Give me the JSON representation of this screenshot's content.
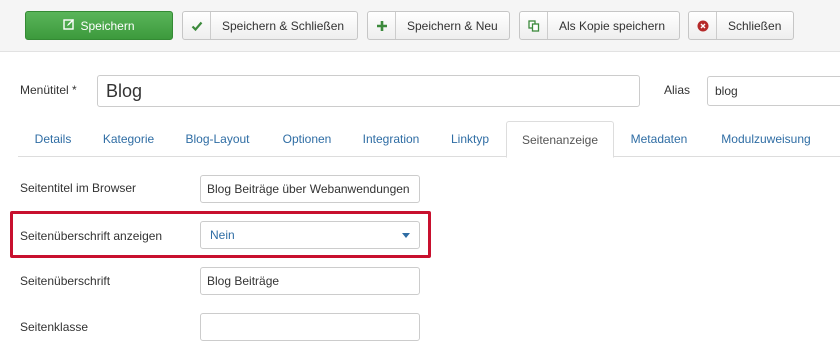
{
  "toolbar": {
    "save_label": "Speichern",
    "save_close_label": "Speichern & Schließen",
    "save_new_label": "Speichern & Neu",
    "save_copy_label": "Als Kopie speichern",
    "close_label": "Schließen"
  },
  "form": {
    "title_label": "Menütitel *",
    "title_value": "Blog",
    "alias_label": "Alias",
    "alias_value": "blog"
  },
  "tabs": [
    {
      "label": "Details"
    },
    {
      "label": "Kategorie"
    },
    {
      "label": "Blog-Layout"
    },
    {
      "label": "Optionen"
    },
    {
      "label": "Integration"
    },
    {
      "label": "Linktyp"
    },
    {
      "label": "Seitenanzeige",
      "active": true
    },
    {
      "label": "Metadaten"
    },
    {
      "label": "Modulzuweisung"
    }
  ],
  "fields": {
    "browser_title_label": "Seitentitel im Browser",
    "browser_title_value": "Blog Beiträge über Webanwendungen",
    "show_heading_label": "Seitenüberschrift anzeigen",
    "show_heading_value": "Nein",
    "heading_label": "Seitenüberschrift",
    "heading_value": "Blog Beiträge",
    "page_class_label": "Seitenklasse",
    "page_class_value": ""
  },
  "colors": {
    "primary_button": "#46a546",
    "link": "#2f6da4",
    "highlight": "#c8102e",
    "close_icon": "#b52a2a"
  }
}
